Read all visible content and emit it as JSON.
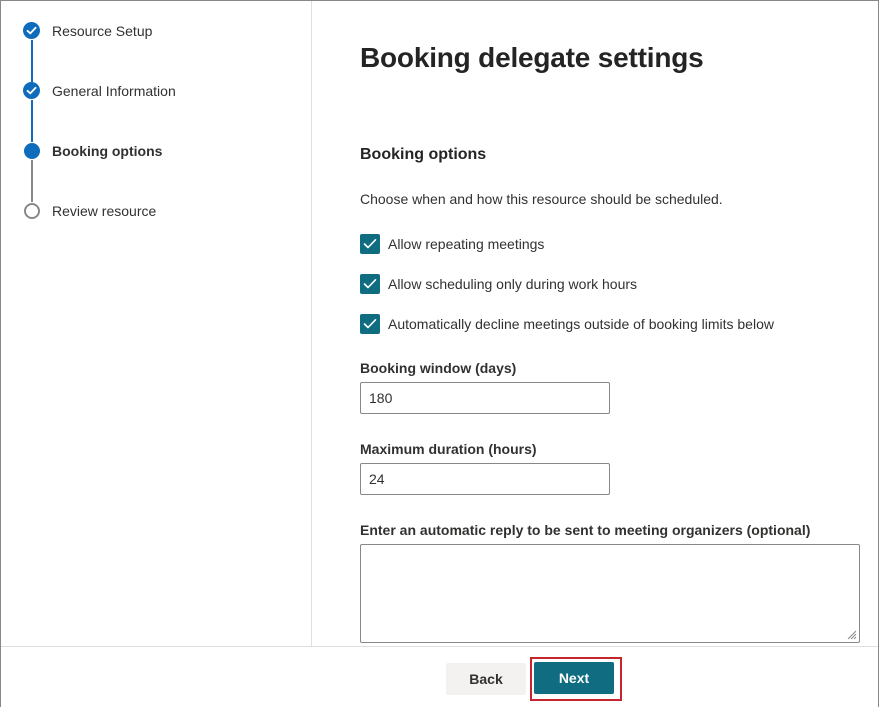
{
  "steps": [
    {
      "label": "Resource Setup",
      "state": "done"
    },
    {
      "label": "General Information",
      "state": "done"
    },
    {
      "label": "Booking options",
      "state": "current"
    },
    {
      "label": "Review resource",
      "state": "todo"
    }
  ],
  "main": {
    "title": "Booking delegate settings",
    "section_title": "Booking options",
    "description": "Choose when and how this resource should be scheduled.",
    "checkboxes": [
      {
        "label": "Allow repeating meetings",
        "checked": true
      },
      {
        "label": "Allow scheduling only during work hours",
        "checked": true
      },
      {
        "label": "Automatically decline meetings outside of booking limits below",
        "checked": true
      }
    ],
    "booking_window": {
      "label": "Booking window (days)",
      "value": "180"
    },
    "max_duration": {
      "label": "Maximum duration (hours)",
      "value": "24"
    },
    "auto_reply": {
      "label": "Enter an automatic reply to be sent to meeting organizers (optional)",
      "value": ""
    }
  },
  "footer": {
    "back_label": "Back",
    "next_label": "Next"
  },
  "colors": {
    "accent": "#0f6cbd",
    "primary_button": "#0f6c81",
    "highlight": "#c4262e"
  },
  "icons": {
    "step_done": "checkmark-circle-icon",
    "step_current": "filled-circle-icon",
    "step_todo": "empty-circle-icon",
    "textarea_grip": "resize-grip-icon"
  }
}
